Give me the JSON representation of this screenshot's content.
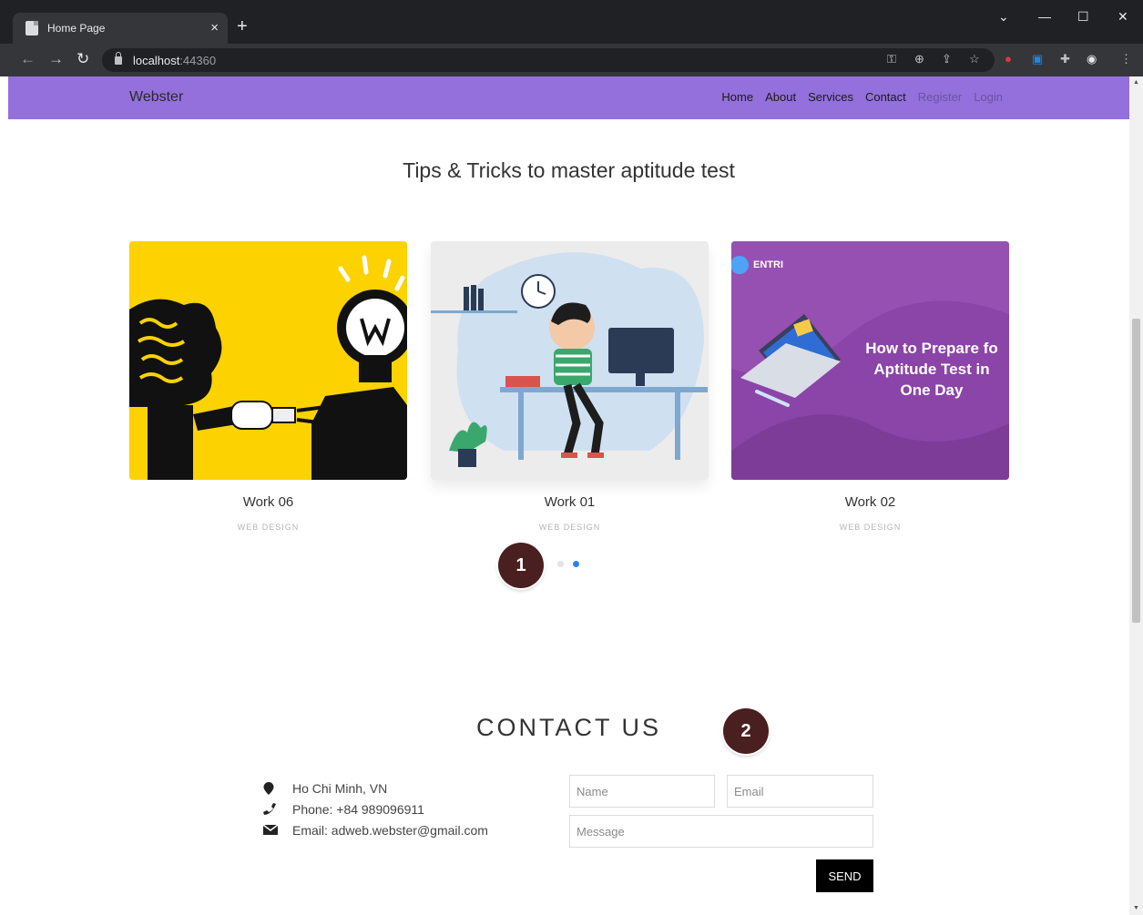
{
  "browser": {
    "tab_title": "Home Page",
    "tab_close": "×",
    "new_tab": "+",
    "url_host": "localhost",
    "url_port": ":44360",
    "window_controls": [
      "⌄",
      "—",
      "☐",
      "✕"
    ]
  },
  "navbar": {
    "brand": "Webster",
    "links": [
      {
        "label": "Home"
      },
      {
        "label": "About"
      },
      {
        "label": "Services"
      },
      {
        "label": "Contact"
      },
      {
        "label": "Register"
      },
      {
        "label": "Login"
      }
    ]
  },
  "portfolio": {
    "title": "Tips & Tricks to master aptitude test",
    "cards": [
      {
        "caption": "Work 06",
        "category": "WEB DESIGN",
        "image": "brain-plug-bulb-illustration"
      },
      {
        "caption": "Work 01",
        "category": "WEB DESIGN",
        "image": "boy-at-computer-illustration"
      },
      {
        "caption": "Work 02",
        "category": "WEB DESIGN",
        "image": "laptop-promo-image",
        "brand_text": "ENTRI",
        "headline": [
          "How to Prepare fo",
          "Aptitude Test in",
          "One Day"
        ]
      }
    ],
    "carousel": {
      "active_index": 1,
      "count": 2
    }
  },
  "badges": {
    "one": "1",
    "two": "2"
  },
  "contact": {
    "title": "CONTACT US",
    "address": "Ho Chi Minh, VN",
    "phone": "Phone: +84 989096911",
    "email": "Email: adweb.webster@gmail.com",
    "name_placeholder": "Name",
    "email_placeholder": "Email",
    "message_placeholder": "Message",
    "send_label": "SEND"
  },
  "colors": {
    "navbar": "#9370db",
    "badge": "#4a1f1f",
    "card1_bg": "#fcd200",
    "card3_bg": "#8b44a8",
    "active_dot": "#2d7ff9"
  }
}
